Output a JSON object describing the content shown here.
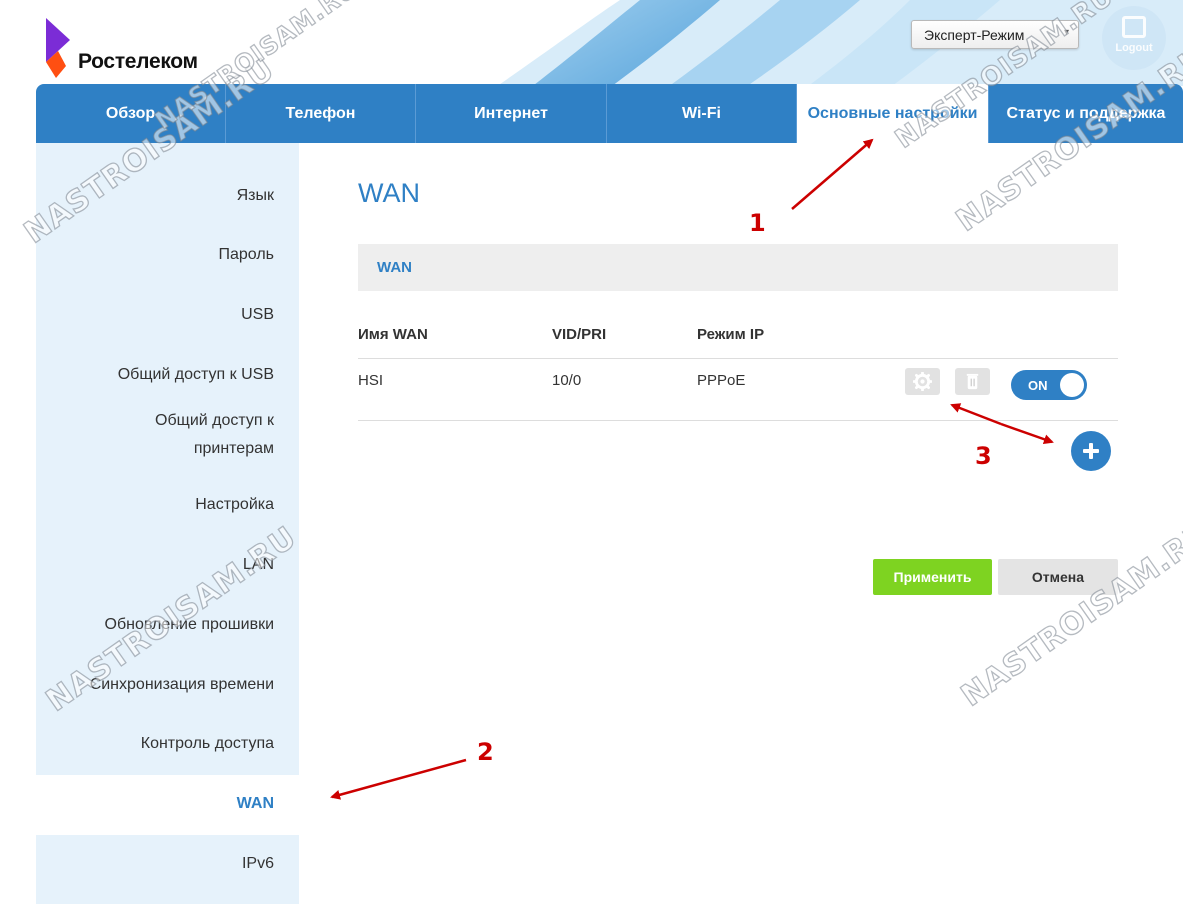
{
  "header": {
    "logo_text": "Ростелеком",
    "mode_select": {
      "value": "Эксперт-Режим",
      "caret": "▾"
    },
    "logout_label": "Logout"
  },
  "nav": {
    "tabs": [
      {
        "label": "Обзор"
      },
      {
        "label": "Телефон"
      },
      {
        "label": "Интернет"
      },
      {
        "label": "Wi-Fi"
      },
      {
        "label": "Основные настройки",
        "active": true
      },
      {
        "label": "Статус и поддержка"
      }
    ]
  },
  "sidebar": {
    "items": [
      {
        "label": "Язык"
      },
      {
        "label": "Пароль"
      },
      {
        "label": "USB"
      },
      {
        "label": "Общий доступ к USB"
      },
      {
        "label": "Общий доступ к принтерам"
      },
      {
        "label": "Настройка"
      },
      {
        "label": "LAN"
      },
      {
        "label": "Обновление прошивки"
      },
      {
        "label": "Синхронизация времени"
      },
      {
        "label": "Контроль доступа"
      },
      {
        "label": "WAN",
        "active": true
      },
      {
        "label": "IPv6"
      }
    ]
  },
  "main": {
    "title": "WAN",
    "section_label": "WAN",
    "table": {
      "headers": [
        "Имя WAN",
        "VID/PRI",
        "Режим IP"
      ],
      "rows": [
        {
          "name": "HSI",
          "vid_pri": "10/0",
          "ip_mode": "PPPoE",
          "enabled_label": "ON"
        }
      ]
    },
    "apply_label": "Применить",
    "cancel_label": "Отмена"
  },
  "annotations": [
    "1",
    "2",
    "3"
  ],
  "watermark_text": "NASTROISAM.RU",
  "colors": {
    "accent_blue": "#2f80c5",
    "sidebar_bg": "#e6f2fb",
    "apply_green": "#7ed321",
    "annotation_red": "#cc0000"
  }
}
